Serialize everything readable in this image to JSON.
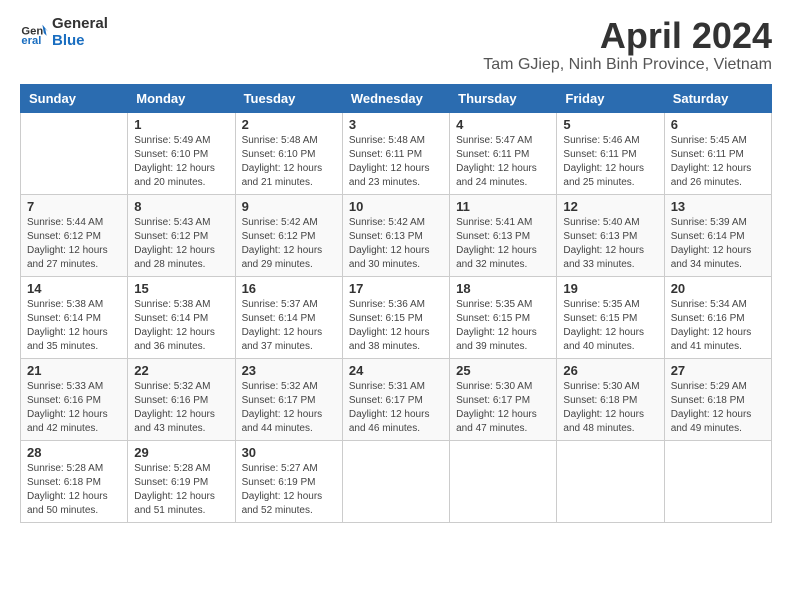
{
  "logo": {
    "line1": "General",
    "line2": "Blue"
  },
  "title": "April 2024",
  "subtitle": "Tam GJiep, Ninh Binh Province, Vietnam",
  "header_days": [
    "Sunday",
    "Monday",
    "Tuesday",
    "Wednesday",
    "Thursday",
    "Friday",
    "Saturday"
  ],
  "weeks": [
    [
      {
        "day": "",
        "sunrise": "",
        "sunset": "",
        "daylight": ""
      },
      {
        "day": "1",
        "sunrise": "Sunrise: 5:49 AM",
        "sunset": "Sunset: 6:10 PM",
        "daylight": "Daylight: 12 hours and 20 minutes."
      },
      {
        "day": "2",
        "sunrise": "Sunrise: 5:48 AM",
        "sunset": "Sunset: 6:10 PM",
        "daylight": "Daylight: 12 hours and 21 minutes."
      },
      {
        "day": "3",
        "sunrise": "Sunrise: 5:48 AM",
        "sunset": "Sunset: 6:11 PM",
        "daylight": "Daylight: 12 hours and 23 minutes."
      },
      {
        "day": "4",
        "sunrise": "Sunrise: 5:47 AM",
        "sunset": "Sunset: 6:11 PM",
        "daylight": "Daylight: 12 hours and 24 minutes."
      },
      {
        "day": "5",
        "sunrise": "Sunrise: 5:46 AM",
        "sunset": "Sunset: 6:11 PM",
        "daylight": "Daylight: 12 hours and 25 minutes."
      },
      {
        "day": "6",
        "sunrise": "Sunrise: 5:45 AM",
        "sunset": "Sunset: 6:11 PM",
        "daylight": "Daylight: 12 hours and 26 minutes."
      }
    ],
    [
      {
        "day": "7",
        "sunrise": "Sunrise: 5:44 AM",
        "sunset": "Sunset: 6:12 PM",
        "daylight": "Daylight: 12 hours and 27 minutes."
      },
      {
        "day": "8",
        "sunrise": "Sunrise: 5:43 AM",
        "sunset": "Sunset: 6:12 PM",
        "daylight": "Daylight: 12 hours and 28 minutes."
      },
      {
        "day": "9",
        "sunrise": "Sunrise: 5:42 AM",
        "sunset": "Sunset: 6:12 PM",
        "daylight": "Daylight: 12 hours and 29 minutes."
      },
      {
        "day": "10",
        "sunrise": "Sunrise: 5:42 AM",
        "sunset": "Sunset: 6:13 PM",
        "daylight": "Daylight: 12 hours and 30 minutes."
      },
      {
        "day": "11",
        "sunrise": "Sunrise: 5:41 AM",
        "sunset": "Sunset: 6:13 PM",
        "daylight": "Daylight: 12 hours and 32 minutes."
      },
      {
        "day": "12",
        "sunrise": "Sunrise: 5:40 AM",
        "sunset": "Sunset: 6:13 PM",
        "daylight": "Daylight: 12 hours and 33 minutes."
      },
      {
        "day": "13",
        "sunrise": "Sunrise: 5:39 AM",
        "sunset": "Sunset: 6:14 PM",
        "daylight": "Daylight: 12 hours and 34 minutes."
      }
    ],
    [
      {
        "day": "14",
        "sunrise": "Sunrise: 5:38 AM",
        "sunset": "Sunset: 6:14 PM",
        "daylight": "Daylight: 12 hours and 35 minutes."
      },
      {
        "day": "15",
        "sunrise": "Sunrise: 5:38 AM",
        "sunset": "Sunset: 6:14 PM",
        "daylight": "Daylight: 12 hours and 36 minutes."
      },
      {
        "day": "16",
        "sunrise": "Sunrise: 5:37 AM",
        "sunset": "Sunset: 6:14 PM",
        "daylight": "Daylight: 12 hours and 37 minutes."
      },
      {
        "day": "17",
        "sunrise": "Sunrise: 5:36 AM",
        "sunset": "Sunset: 6:15 PM",
        "daylight": "Daylight: 12 hours and 38 minutes."
      },
      {
        "day": "18",
        "sunrise": "Sunrise: 5:35 AM",
        "sunset": "Sunset: 6:15 PM",
        "daylight": "Daylight: 12 hours and 39 minutes."
      },
      {
        "day": "19",
        "sunrise": "Sunrise: 5:35 AM",
        "sunset": "Sunset: 6:15 PM",
        "daylight": "Daylight: 12 hours and 40 minutes."
      },
      {
        "day": "20",
        "sunrise": "Sunrise: 5:34 AM",
        "sunset": "Sunset: 6:16 PM",
        "daylight": "Daylight: 12 hours and 41 minutes."
      }
    ],
    [
      {
        "day": "21",
        "sunrise": "Sunrise: 5:33 AM",
        "sunset": "Sunset: 6:16 PM",
        "daylight": "Daylight: 12 hours and 42 minutes."
      },
      {
        "day": "22",
        "sunrise": "Sunrise: 5:32 AM",
        "sunset": "Sunset: 6:16 PM",
        "daylight": "Daylight: 12 hours and 43 minutes."
      },
      {
        "day": "23",
        "sunrise": "Sunrise: 5:32 AM",
        "sunset": "Sunset: 6:17 PM",
        "daylight": "Daylight: 12 hours and 44 minutes."
      },
      {
        "day": "24",
        "sunrise": "Sunrise: 5:31 AM",
        "sunset": "Sunset: 6:17 PM",
        "daylight": "Daylight: 12 hours and 46 minutes."
      },
      {
        "day": "25",
        "sunrise": "Sunrise: 5:30 AM",
        "sunset": "Sunset: 6:17 PM",
        "daylight": "Daylight: 12 hours and 47 minutes."
      },
      {
        "day": "26",
        "sunrise": "Sunrise: 5:30 AM",
        "sunset": "Sunset: 6:18 PM",
        "daylight": "Daylight: 12 hours and 48 minutes."
      },
      {
        "day": "27",
        "sunrise": "Sunrise: 5:29 AM",
        "sunset": "Sunset: 6:18 PM",
        "daylight": "Daylight: 12 hours and 49 minutes."
      }
    ],
    [
      {
        "day": "28",
        "sunrise": "Sunrise: 5:28 AM",
        "sunset": "Sunset: 6:18 PM",
        "daylight": "Daylight: 12 hours and 50 minutes."
      },
      {
        "day": "29",
        "sunrise": "Sunrise: 5:28 AM",
        "sunset": "Sunset: 6:19 PM",
        "daylight": "Daylight: 12 hours and 51 minutes."
      },
      {
        "day": "30",
        "sunrise": "Sunrise: 5:27 AM",
        "sunset": "Sunset: 6:19 PM",
        "daylight": "Daylight: 12 hours and 52 minutes."
      },
      {
        "day": "",
        "sunrise": "",
        "sunset": "",
        "daylight": ""
      },
      {
        "day": "",
        "sunrise": "",
        "sunset": "",
        "daylight": ""
      },
      {
        "day": "",
        "sunrise": "",
        "sunset": "",
        "daylight": ""
      },
      {
        "day": "",
        "sunrise": "",
        "sunset": "",
        "daylight": ""
      }
    ]
  ]
}
